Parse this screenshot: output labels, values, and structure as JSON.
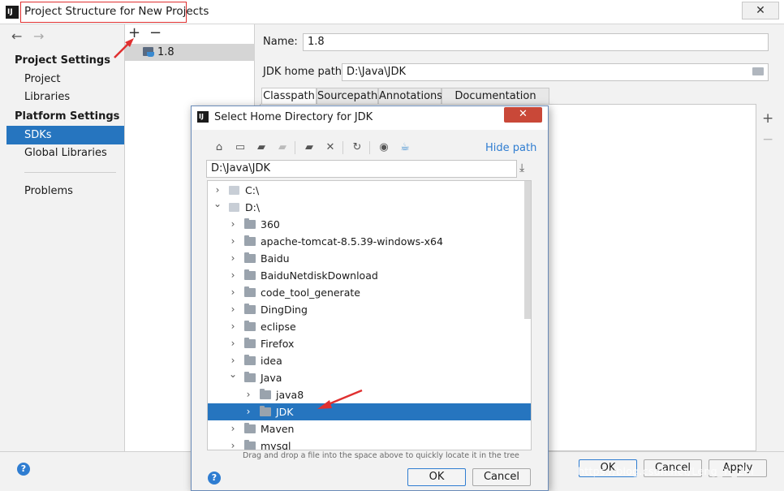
{
  "window": {
    "title": "Project Structure for New Projects",
    "close_glyph": "✕"
  },
  "nav": {
    "back_glyph": "←",
    "forward_glyph": "→",
    "project_settings_header": "Project Settings",
    "project": "Project",
    "libraries": "Libraries",
    "platform_settings_header": "Platform Settings",
    "sdks": "SDKs",
    "global_libraries": "Global Libraries",
    "problems": "Problems"
  },
  "sdk_list": {
    "add_glyph": "+",
    "remove_glyph": "−",
    "items": [
      "1.8"
    ]
  },
  "details": {
    "name_label": "Name:",
    "name_value": "1.8",
    "jdk_home_label": "JDK home path:",
    "jdk_home_value": "D:\\Java\\JDK",
    "tabs": [
      "Classpath",
      "Sourcepath",
      "Annotations",
      "Documentation Paths"
    ],
    "side_add_glyph": "+",
    "side_remove_glyph": "−"
  },
  "footer": {
    "help_glyph": "?",
    "ok": "OK",
    "cancel": "Cancel",
    "apply": "Apply",
    "watermark": "https://blog.csdn.net/Leng_Yi_Zhi"
  },
  "dialog": {
    "title": "Select Home Directory for JDK",
    "close_glyph": "✕",
    "hide_path": "Hide path",
    "path_value": "D:\\Java\\JDK",
    "download_glyph": "⤓",
    "tree": [
      {
        "label": "C:\\",
        "expanded": false,
        "kind": "drive",
        "level": 0
      },
      {
        "label": "D:\\",
        "expanded": true,
        "kind": "drive",
        "level": 0
      },
      {
        "label": "360",
        "expanded": false,
        "kind": "folder",
        "level": 1
      },
      {
        "label": "apache-tomcat-8.5.39-windows-x64",
        "expanded": false,
        "kind": "folder",
        "level": 1
      },
      {
        "label": "Baidu",
        "expanded": false,
        "kind": "folder",
        "level": 1
      },
      {
        "label": "BaiduNetdiskDownload",
        "expanded": false,
        "kind": "folder",
        "level": 1
      },
      {
        "label": "code_tool_generate",
        "expanded": false,
        "kind": "folder",
        "level": 1
      },
      {
        "label": "DingDing",
        "expanded": false,
        "kind": "folder",
        "level": 1
      },
      {
        "label": "eclipse",
        "expanded": false,
        "kind": "folder",
        "level": 1
      },
      {
        "label": "Firefox",
        "expanded": false,
        "kind": "folder",
        "level": 1
      },
      {
        "label": "idea",
        "expanded": false,
        "kind": "folder",
        "level": 1
      },
      {
        "label": "Java",
        "expanded": true,
        "kind": "folder",
        "level": 1
      },
      {
        "label": "java8",
        "expanded": false,
        "kind": "folder",
        "level": 2
      },
      {
        "label": "JDK",
        "expanded": false,
        "kind": "folder",
        "level": 2,
        "selected": true
      },
      {
        "label": "Maven",
        "expanded": false,
        "kind": "folder",
        "level": 1
      },
      {
        "label": "mysql",
        "expanded": false,
        "kind": "folder",
        "level": 1
      }
    ],
    "hint": "Drag and drop a file into the space above to quickly locate it in the tree",
    "help_glyph": "?",
    "ok": "OK",
    "cancel": "Cancel"
  },
  "colors": {
    "selection": "#2675bf",
    "annotation_red": "#e03030",
    "dialog_close": "#c94838"
  }
}
